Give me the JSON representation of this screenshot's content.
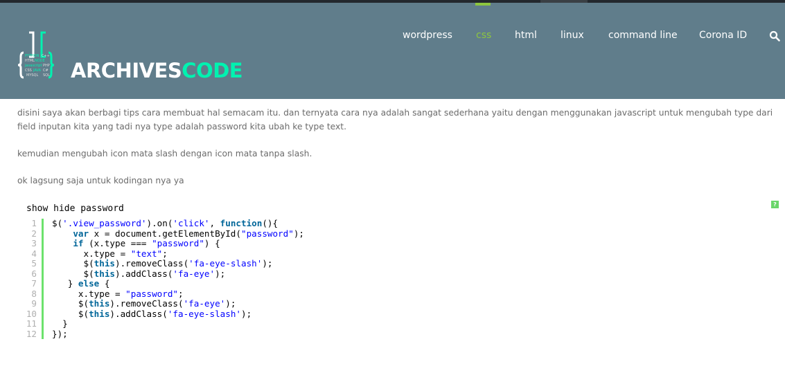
{
  "site": {
    "logo_part1": "ARCHIVES",
    "logo_part2": "CODE",
    "brand_color": "#00f2b0",
    "header_bg": "#607d8b",
    "accent": "#8dc63f"
  },
  "nav": {
    "items": [
      {
        "label": "wordpress",
        "active": false
      },
      {
        "label": "css",
        "active": true
      },
      {
        "label": "html",
        "active": false
      },
      {
        "label": "linux",
        "active": false
      },
      {
        "label": "command line",
        "active": false
      },
      {
        "label": "Corona ID",
        "active": false
      }
    ],
    "search_icon": "search-icon"
  },
  "content": {
    "paragraphs": [
      "disini saya akan berbagi tips cara membuat hal semacam itu. dan ternyata cara nya adalah sangat sederhana yaitu dengan menggunakan javascript untuk mengubah type dari field inputan kita yang tadi nya type adalah password kita ubah ke type text.",
      "kemudian mengubah icon mata slash dengan icon mata tanpa slash.",
      "ok lagsung saja untuk kodingan nya ya"
    ]
  },
  "code": {
    "title": "show hide password",
    "help_label": "?",
    "lines": [
      [
        [
          "",
          "$("
        ],
        [
          "str",
          "'.view_password'"
        ],
        [
          "",
          ").on("
        ],
        [
          "str",
          "'click'"
        ],
        [
          "",
          ", "
        ],
        [
          "kw",
          "function"
        ],
        [
          "",
          "(){"
        ]
      ],
      [
        [
          "",
          "    "
        ],
        [
          "kw",
          "var"
        ],
        [
          "",
          " x = document.getElementById("
        ],
        [
          "str",
          "\"password\""
        ],
        [
          "",
          ");"
        ]
      ],
      [
        [
          "",
          "    "
        ],
        [
          "kw",
          "if"
        ],
        [
          "",
          " (x.type === "
        ],
        [
          "str",
          "\"password\""
        ],
        [
          "",
          ") {"
        ]
      ],
      [
        [
          "",
          "      x.type = "
        ],
        [
          "str",
          "\"text\""
        ],
        [
          "",
          ";"
        ]
      ],
      [
        [
          "",
          "      $("
        ],
        [
          "kw",
          "this"
        ],
        [
          "",
          ").removeClass("
        ],
        [
          "str",
          "'fa-eye-slash'"
        ],
        [
          "",
          ");"
        ]
      ],
      [
        [
          "",
          "      $("
        ],
        [
          "kw",
          "this"
        ],
        [
          "",
          ").addClass("
        ],
        [
          "str",
          "'fa-eye'"
        ],
        [
          "",
          ");"
        ]
      ],
      [
        [
          "",
          "   } "
        ],
        [
          "kw",
          "else"
        ],
        [
          "",
          " {"
        ]
      ],
      [
        [
          "",
          "     x.type = "
        ],
        [
          "str",
          "\"password\""
        ],
        [
          "",
          ";"
        ]
      ],
      [
        [
          "",
          "     $("
        ],
        [
          "kw",
          "this"
        ],
        [
          "",
          ").removeClass("
        ],
        [
          "str",
          "'fa-eye'"
        ],
        [
          "",
          ");"
        ]
      ],
      [
        [
          "",
          "     $("
        ],
        [
          "kw",
          "this"
        ],
        [
          "",
          ").addClass("
        ],
        [
          "str",
          "'fa-eye-slash'"
        ],
        [
          "",
          ");"
        ]
      ],
      [
        [
          "",
          "  }"
        ]
      ],
      [
        [
          "",
          "});"
        ]
      ]
    ]
  }
}
